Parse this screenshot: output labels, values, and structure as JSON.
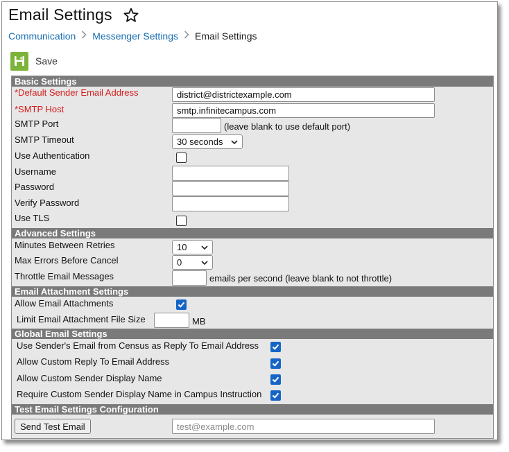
{
  "page": {
    "title": "Email Settings",
    "breadcrumb": [
      "Communication",
      "Messenger Settings",
      "Email Settings"
    ]
  },
  "toolbar": {
    "save_label": "Save"
  },
  "sections": {
    "basic": "Basic Settings",
    "advanced": "Advanced Settings",
    "attachment": "Email Attachment Settings",
    "global": "Global Email Settings",
    "test": "Test Email Settings Configuration"
  },
  "basic": {
    "sender_label": "*Default Sender Email Address",
    "sender_value": "district@districtexample.com",
    "smtp_host_label": "*SMTP Host",
    "smtp_host_value": "smtp.infinitecampus.com",
    "smtp_port_label": "SMTP Port",
    "smtp_port_value": "",
    "smtp_port_hint": "(leave blank to use default port)",
    "timeout_label": "SMTP Timeout",
    "timeout_value": "30 seconds",
    "use_auth_label": "Use Authentication",
    "use_auth_checked": false,
    "username_label": "Username",
    "username_value": "",
    "password_label": "Password",
    "password_value": "",
    "verify_password_label": "Verify Password",
    "verify_password_value": "",
    "use_tls_label": "Use TLS",
    "use_tls_checked": false
  },
  "advanced": {
    "retries_label": "Minutes Between Retries",
    "retries_value": "10",
    "max_errors_label": "Max Errors Before Cancel",
    "max_errors_value": "0",
    "throttle_label": "Throttle Email Messages",
    "throttle_value": "",
    "throttle_hint": "emails per second (leave blank to not throttle)"
  },
  "attachment": {
    "allow_label": "Allow Email Attachments",
    "allow_checked": true,
    "limit_label": "Limit Email Attachment File Size",
    "limit_value": "",
    "limit_unit": "MB"
  },
  "global": {
    "census_reply_label": "Use Sender's Email from Census as Reply To Email Address",
    "census_reply_checked": true,
    "custom_reply_label": "Allow Custom Reply To Email Address",
    "custom_reply_checked": true,
    "custom_display_label": "Allow Custom Sender Display Name",
    "custom_display_checked": true,
    "require_display_label": "Require Custom Sender Display Name in Campus Instruction",
    "require_display_checked": true
  },
  "test": {
    "button_label": "Send Test Email",
    "email_placeholder": "test@example.com",
    "email_value": ""
  },
  "icons": {
    "favorite": "star-outline-icon",
    "save": "floppy-disk-icon",
    "breadcrumb_separator": "chevron-right-icon",
    "dropdown": "chevron-down-icon",
    "checkmark": "check-icon"
  },
  "colors": {
    "link": "#1a6fb3",
    "required": "#d31a1a",
    "save_green": "#7db33a",
    "section_header": "#7a7a7a",
    "checkbox_checked": "#1565c7",
    "panel_bg": "#e7e7e7"
  }
}
